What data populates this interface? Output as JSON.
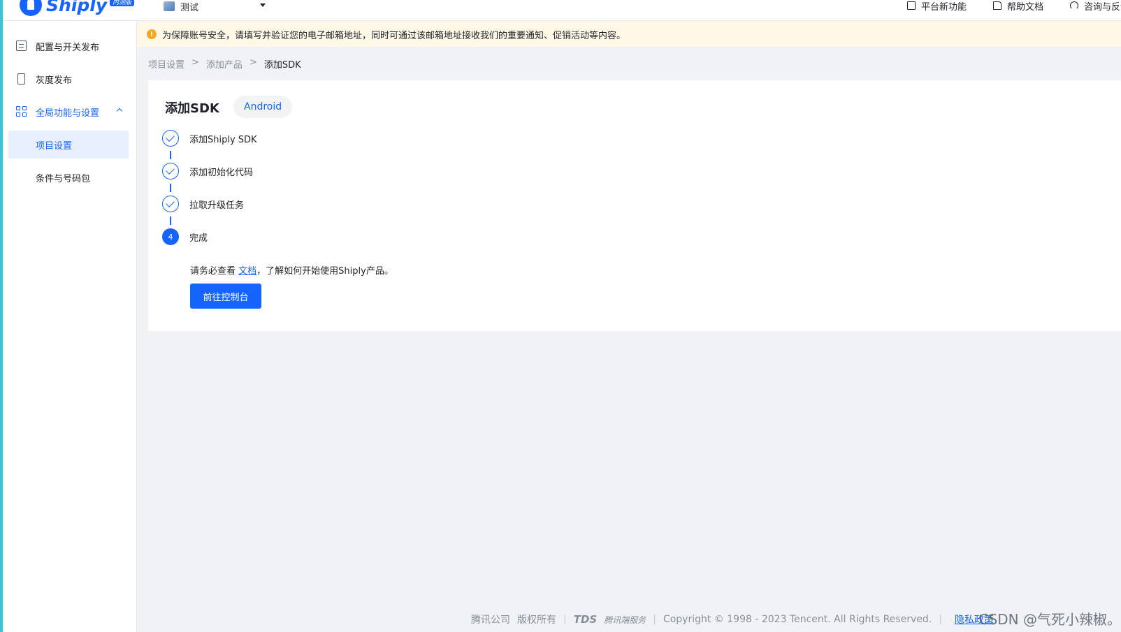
{
  "header": {
    "logo_text": "Shiply",
    "logo_badge": "内测版",
    "project_name": "测试",
    "links": [
      {
        "label": "平台新功能",
        "icon": "new-feature-icon"
      },
      {
        "label": "帮助文档",
        "icon": "document-icon"
      },
      {
        "label": "咨询与反馈",
        "icon": "headset-icon"
      }
    ]
  },
  "sidebar": {
    "items": [
      {
        "label": "配置与开关发布",
        "icon": "list-icon"
      },
      {
        "label": "灰度发布",
        "icon": "phone-icon"
      },
      {
        "label": "全局功能与设置",
        "icon": "grid-icon",
        "expanded": true
      }
    ],
    "sub_items": [
      {
        "label": "项目设置",
        "selected": true
      },
      {
        "label": "条件与号码包",
        "selected": false
      }
    ]
  },
  "notice": {
    "icon": "!",
    "text": "为保障账号安全，请填写并验证您的电子邮箱地址，同时可通过该邮箱地址接收我们的重要通知、促销活动等内容。"
  },
  "breadcrumb": {
    "items": [
      "项目设置",
      "添加产品",
      "添加SDK"
    ],
    "separator": ">"
  },
  "main": {
    "title": "添加SDK",
    "platform": "Android",
    "steps": [
      {
        "label": "添加Shiply SDK",
        "status": "done"
      },
      {
        "label": "添加初始化代码",
        "status": "done"
      },
      {
        "label": "拉取升级任务",
        "status": "done"
      },
      {
        "label": "完成",
        "status": "current",
        "number": "4"
      }
    ],
    "hint_prefix": "请务必查看",
    "hint_link": "文档",
    "hint_suffix": "，了解如何开始使用Shiply产品。",
    "button_label": "前往控制台"
  },
  "footer": {
    "company": "腾讯公司",
    "rights": "版权所有",
    "tds_logo": "TDS",
    "tds_text": "腾讯端服务",
    "copyright": "Copyright © 1998 - 2023 Tencent. All Rights Reserved.",
    "privacy": "隐私政策"
  },
  "watermark": "CSDN @气死小辣椒。",
  "colors": {
    "primary": "#1664ff",
    "notice_bg": "#fff8e6",
    "warning": "#f5a623",
    "left_strip": "#3dc4d8"
  }
}
